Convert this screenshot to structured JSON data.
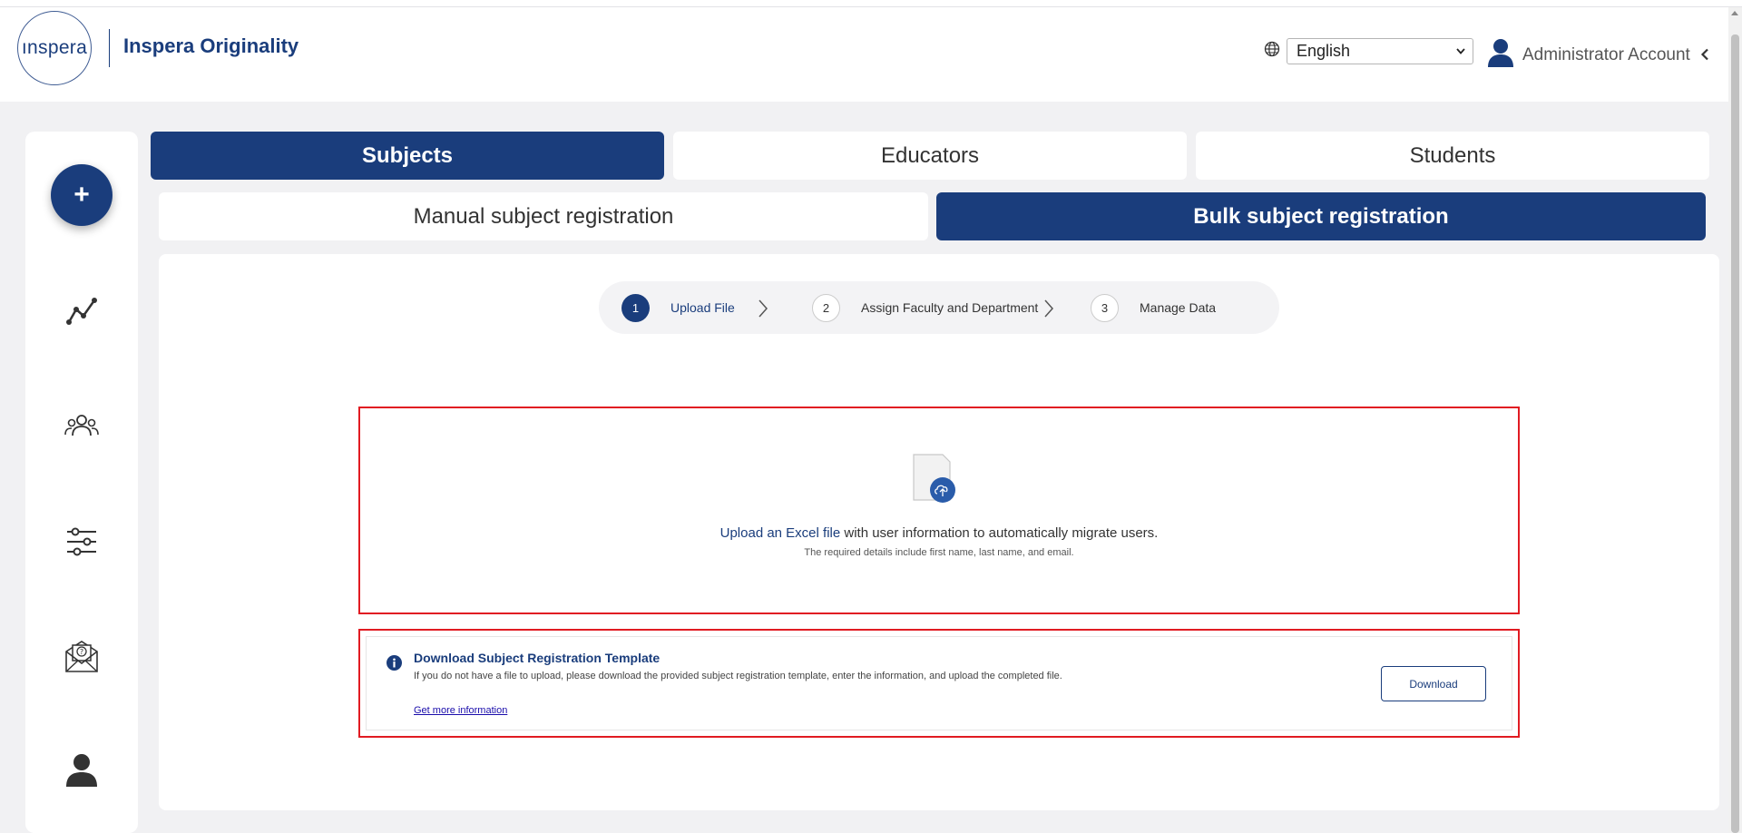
{
  "header": {
    "logo_text": "ınspera",
    "brand": "Inspera Originality",
    "language": {
      "selected": "English"
    },
    "account": {
      "name": "Administrator Account"
    }
  },
  "sidebar": {
    "add_label": "+",
    "icons": [
      "analytics-icon",
      "users-group-icon",
      "settings-sliders-icon",
      "mail-help-icon",
      "profile-icon"
    ]
  },
  "tabs": [
    {
      "label": "Subjects",
      "active": true
    },
    {
      "label": "Educators",
      "active": false
    },
    {
      "label": "Students",
      "active": false
    }
  ],
  "subtabs": [
    {
      "label": "Manual subject registration",
      "active": false
    },
    {
      "label": "Bulk subject registration",
      "active": true
    }
  ],
  "stepper": {
    "steps": [
      {
        "number": "1",
        "label": "Upload File",
        "active": true
      },
      {
        "number": "2",
        "label": "Assign Faculty and Department",
        "active": false
      },
      {
        "number": "3",
        "label": "Manage Data",
        "active": false
      }
    ]
  },
  "upload": {
    "link_text": "Upload an Excel file",
    "text_rest": " with user information to automatically migrate users.",
    "subtext": "The required details include first name, last name, and email."
  },
  "template_info": {
    "title": "Download Subject Registration Template",
    "description": "If you do not have a file to upload, please download the provided subject registration template, enter the information, and upload the completed file.",
    "link": "Get more information",
    "button": "Download"
  },
  "colors": {
    "primary": "#1a3d7c",
    "highlight_border": "#e11b22",
    "background": "#f1f1f3"
  }
}
